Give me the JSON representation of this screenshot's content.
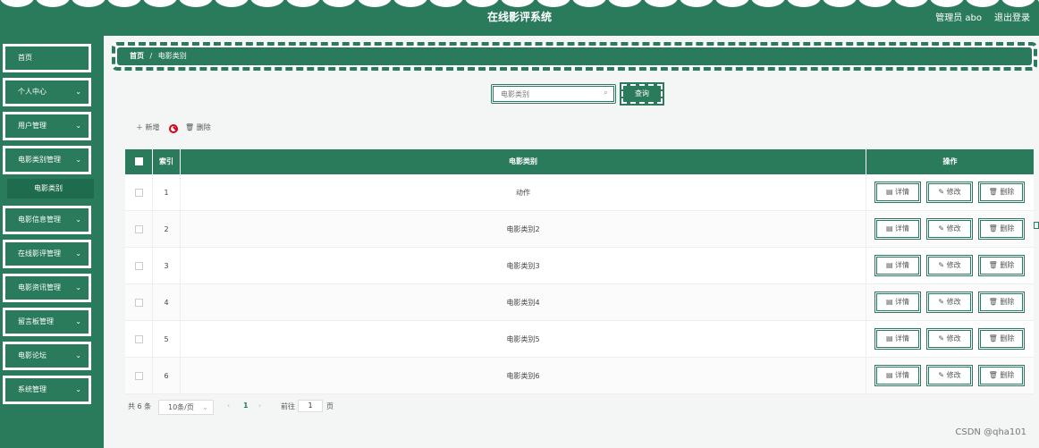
{
  "header": {
    "title": "在线影评系统",
    "admin": "管理员 abo",
    "logout": "退出登录"
  },
  "sidebar": {
    "items": [
      "首页",
      "个人中心",
      "用户管理",
      "电影类别管理",
      "电影信息管理",
      "在线影评管理",
      "电影资讯管理",
      "留言板管理",
      "电影论坛",
      "系统管理"
    ],
    "sub_item": "电影类别"
  },
  "breadcrumb": {
    "home": "首页",
    "sep": "/",
    "current": "电影类别"
  },
  "search": {
    "placeholder": "电影类别",
    "button": "查询"
  },
  "actions": {
    "add": "＋ 新增",
    "delete": "删除"
  },
  "table": {
    "headers": {
      "index": "索引",
      "category": "电影类别",
      "ops": "操作"
    },
    "rows": [
      {
        "index": "1",
        "category": "动作"
      },
      {
        "index": "2",
        "category": "电影类别2"
      },
      {
        "index": "3",
        "category": "电影类别3"
      },
      {
        "index": "4",
        "category": "电影类别4"
      },
      {
        "index": "5",
        "category": "电影类别5"
      },
      {
        "index": "6",
        "category": "电影类别6"
      }
    ],
    "op_labels": {
      "detail": "详情",
      "edit": "修改",
      "delete": "删除"
    }
  },
  "pagination": {
    "total": "共 6 条",
    "page_size": "10条/页",
    "current_page": "1",
    "goto_label": "前往",
    "goto_value": "1",
    "page_unit": "页"
  },
  "watermark": "CSDN @qha101",
  "colors": {
    "primary": "#2a7a5c",
    "ban": "#d0021b"
  }
}
